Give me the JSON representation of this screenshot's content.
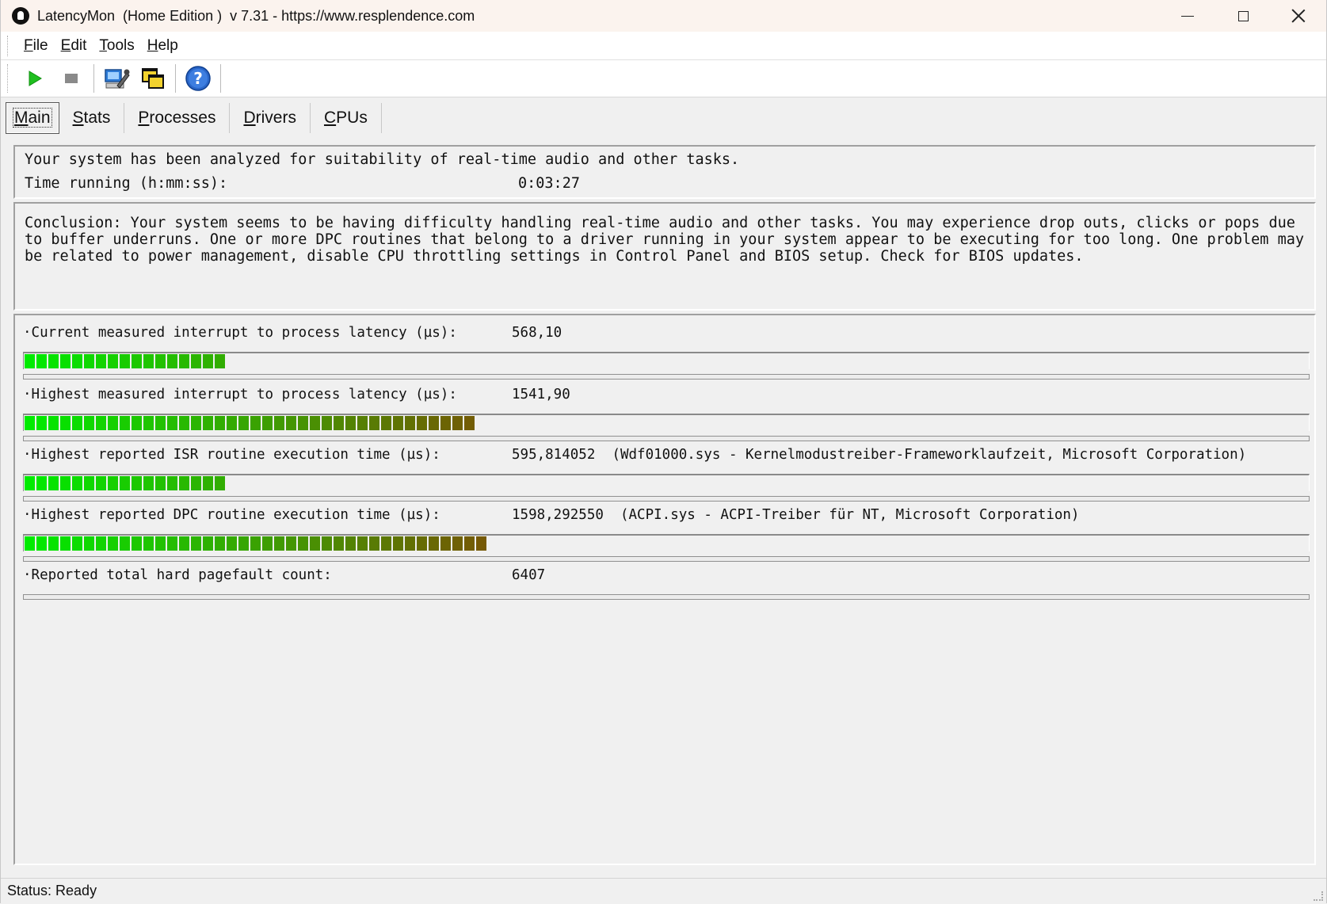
{
  "window": {
    "title": "LatencyMon  (Home Edition )  v 7.31 - https://www.resplendence.com"
  },
  "menu": {
    "items": [
      {
        "first": "F",
        "rest": "ile"
      },
      {
        "first": "E",
        "rest": "dit"
      },
      {
        "first": "T",
        "rest": "ools"
      },
      {
        "first": "H",
        "rest": "elp"
      }
    ]
  },
  "toolbar": {
    "icons": [
      "play-icon",
      "stop-icon",
      "computer-wrench-icon",
      "windows-stack-icon",
      "help-icon"
    ]
  },
  "tabs": [
    {
      "first": "M",
      "rest": "ain"
    },
    {
      "first": "S",
      "rest": "tats"
    },
    {
      "first": "P",
      "rest": "rocesses"
    },
    {
      "first": "D",
      "rest": "rivers"
    },
    {
      "first": "C",
      "rest": "PUs"
    }
  ],
  "summary": {
    "analyzed_text": "Your system has been analyzed for suitability of real-time audio and other tasks.",
    "time_label": "Time running (h:mm:ss):",
    "time_value": "0:03:27"
  },
  "conclusion": {
    "text": "Conclusion: Your system seems to be having difficulty handling real-time audio and other tasks. You may experience drop outs, clicks or pops due to buffer underruns. One or more DPC routines that belong to a driver running in your system appear to be executing for too long. One problem may be related to power management, disable CPU throttling settings in Control Panel and BIOS setup. Check for BIOS updates."
  },
  "metrics": [
    {
      "label": "·Current measured interrupt to process latency (µs):",
      "value": "568,10",
      "extra": "",
      "segments": 17
    },
    {
      "label": "·Highest measured interrupt to process latency (µs):",
      "value": "1541,90",
      "extra": "",
      "segments": 38
    },
    {
      "label": "·Highest reported ISR routine execution time (µs):",
      "value": "595,814052",
      "extra": "(Wdf01000.sys - Kernelmodustreiber-Frameworklaufzeit, Microsoft Corporation)",
      "segments": 17
    },
    {
      "label": "·Highest reported DPC routine execution time (µs):",
      "value": "1598,292550",
      "extra": "(ACPI.sys - ACPI-Treiber für NT, Microsoft Corporation)",
      "segments": 39
    },
    {
      "label": "·Reported total hard pagefault count:",
      "value": "6407",
      "extra": "",
      "segments": 0
    }
  ],
  "status": {
    "text": "Status: Ready"
  }
}
